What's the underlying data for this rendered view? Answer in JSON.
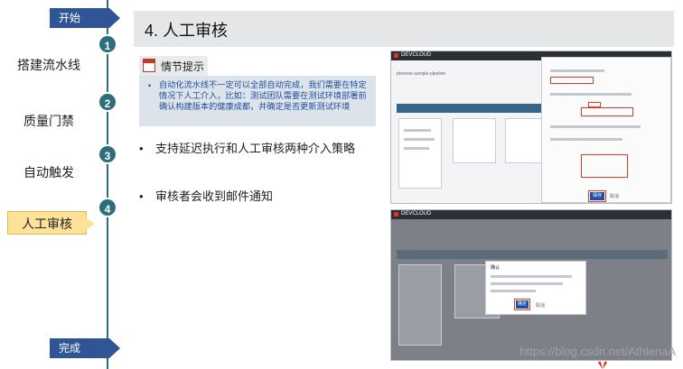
{
  "timeline": {
    "start_label": "开始",
    "end_label": "完成",
    "steps": [
      {
        "num": "1",
        "label": "搭建流水线"
      },
      {
        "num": "2",
        "label": "质量门禁"
      },
      {
        "num": "3",
        "label": "自动触发"
      },
      {
        "num": "4",
        "label": "人工审核"
      }
    ]
  },
  "title": "4. 人工审核",
  "tip": {
    "heading": "情节提示",
    "text": "自动化流水线不一定可以全部自动完成，我们需要在特定情况下人工介入，比如：测试团队需要在测试环境部署前确认构建版本的健康成都，并确定是否更新测试环境"
  },
  "bullets": [
    "支持延迟执行和人工审核两种介入策略",
    "审核者会收到邮件通知"
  ],
  "screenshot1": {
    "app_title": "DEVCLOUD",
    "pipeline_name": "phoenix-sample-pipeline",
    "confirm_button": "保存",
    "cancel_button": "取消"
  },
  "screenshot2": {
    "app_title": "DEVCLOUD",
    "dialog_title": "确认",
    "confirm_button": "确定",
    "cancel_button": "取消"
  },
  "watermark": "https://blog.csdn.net/AthlenaA",
  "colors": {
    "timeline": "#2c6e7a",
    "arrow_tag": "#2f5597",
    "active_step": "#ffe29a",
    "tip_text": "#1f4e9c"
  }
}
